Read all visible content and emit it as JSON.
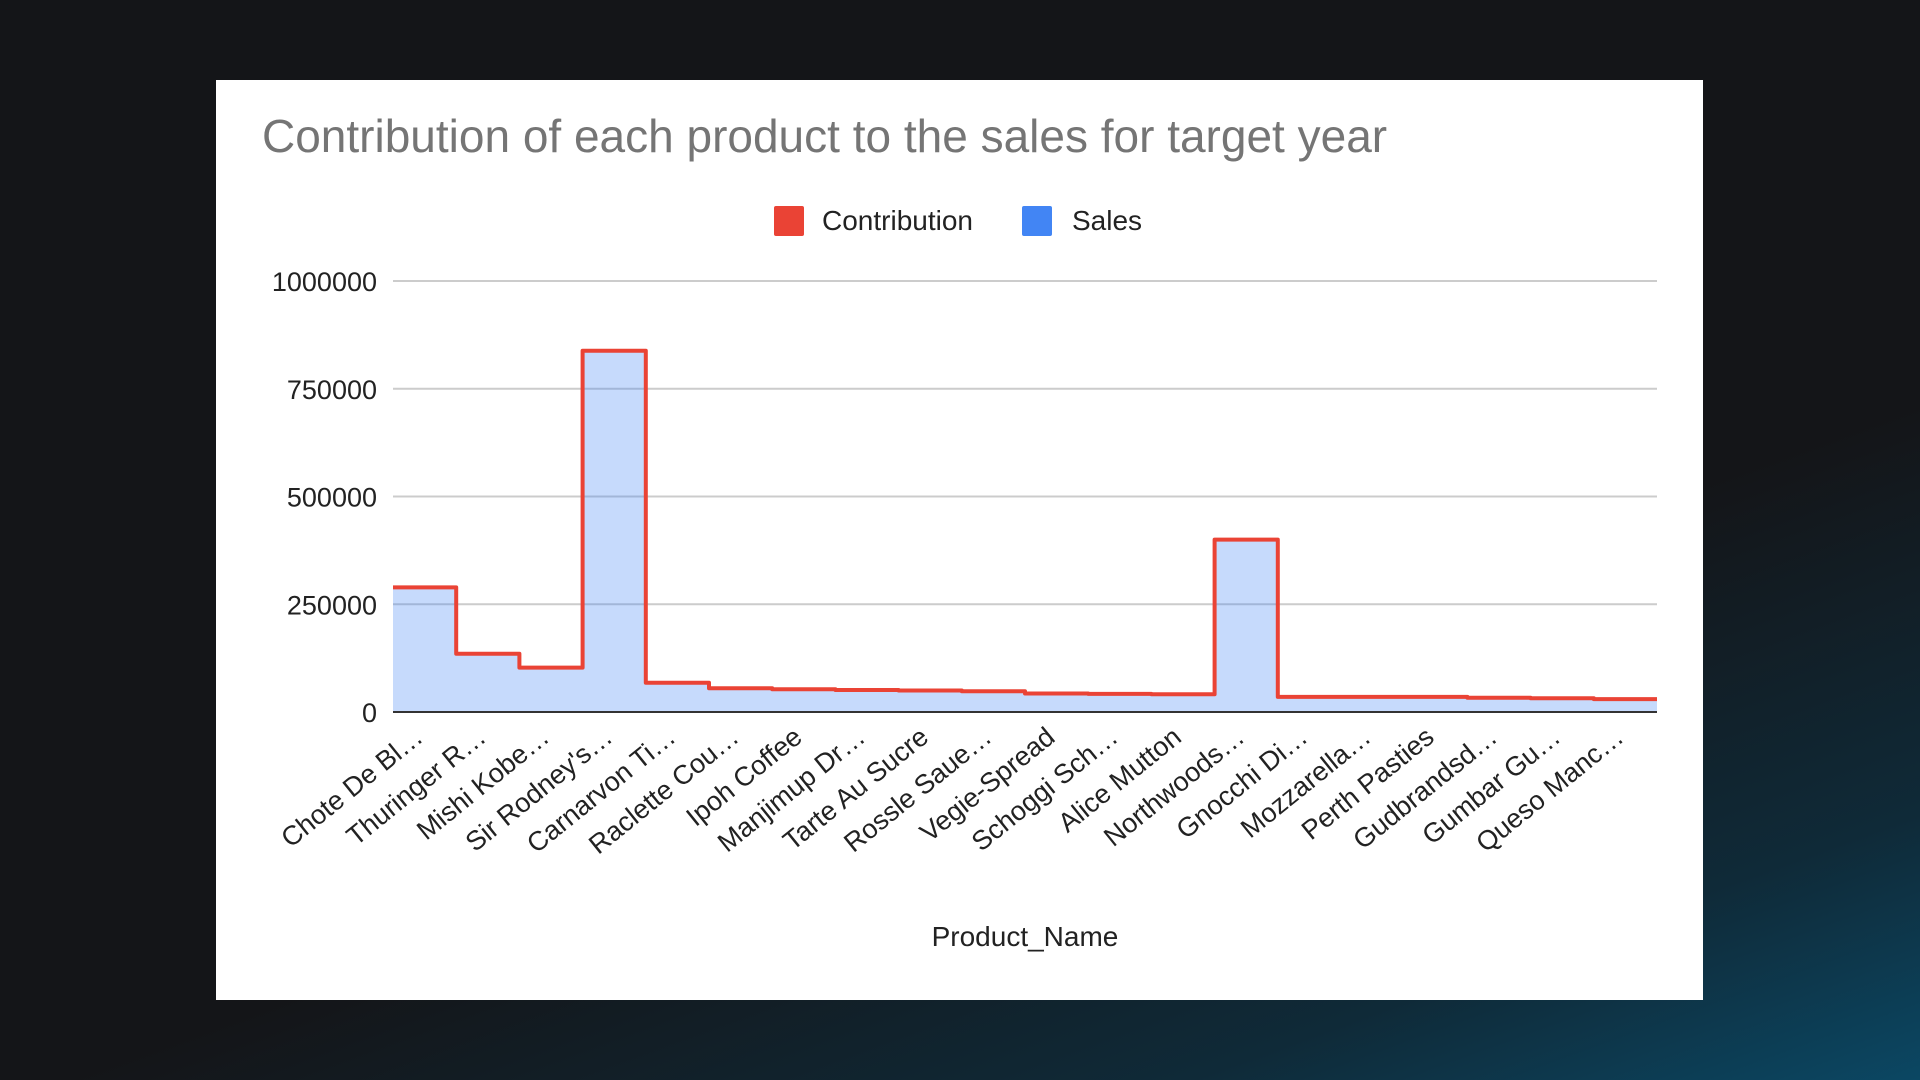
{
  "chart_data": {
    "type": "area",
    "title": "Contribution of each product to the sales for target year",
    "xlabel": "Product_Name",
    "ylabel": "",
    "ylim": [
      0,
      1000000
    ],
    "yticks": [
      0,
      250000,
      500000,
      750000,
      1000000
    ],
    "grid": true,
    "legend_position": "top",
    "interpolation": "stepped",
    "categories": [
      "Chote De Bl…",
      "Thuringer R…",
      "Mishi Kobe…",
      "Sir Rodney's…",
      "Carnarvon Ti…",
      "Raclette Cou…",
      "Ipoh Coffee",
      "Manjimup Dr…",
      "Tarte Au Sucre",
      "Rossle Saue…",
      "Vegie-Spread",
      "Schoggi Sch…",
      "Alice Mutton",
      "Northwoods…",
      "Gnocchi Di…",
      "Mozzarella…",
      "Perth Pasties",
      "Gudbrandsd…",
      "Gumbar Gu…",
      "Queso Manc…"
    ],
    "series": [
      {
        "name": "Contribution",
        "color": "#ea4335",
        "values": [
          289000,
          135000,
          103000,
          838000,
          68000,
          55000,
          53000,
          51000,
          50000,
          48000,
          43000,
          42000,
          41000,
          400000,
          35000,
          35000,
          35000,
          33000,
          32000,
          30000
        ]
      },
      {
        "name": "Sales",
        "color": "#4285f4",
        "values": [
          289000,
          135000,
          103000,
          838000,
          68000,
          55000,
          53000,
          51000,
          50000,
          48000,
          43000,
          42000,
          41000,
          400000,
          35000,
          35000,
          35000,
          33000,
          32000,
          30000
        ]
      }
    ]
  }
}
